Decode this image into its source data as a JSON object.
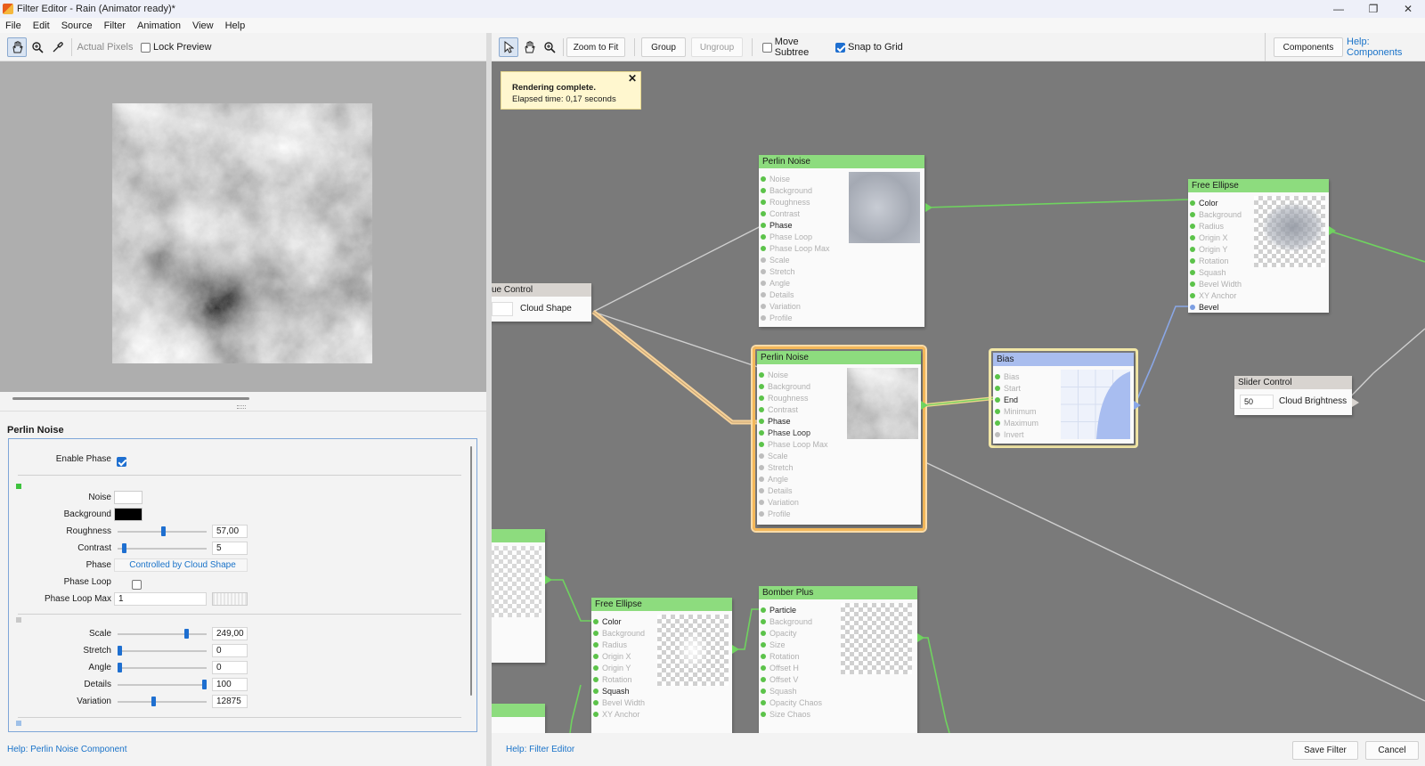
{
  "window": {
    "title": "Filter Editor - Rain (Animator ready)*"
  },
  "menu": [
    "File",
    "Edit",
    "Source",
    "Filter",
    "Animation",
    "View",
    "Help"
  ],
  "left_toolbar": {
    "actual_pixels": "Actual Pixels",
    "lock_preview": "Lock Preview"
  },
  "right_toolbar": {
    "zoom_to_fit": "Zoom to Fit",
    "group": "Group",
    "ungroup": "Ungroup",
    "move_subtree": "Move Subtree",
    "snap_to_grid": "Snap to Grid",
    "components": "Components",
    "help_components": "Help: Components"
  },
  "toast": {
    "title": "Rendering complete.",
    "subtitle": "Elapsed time: 0,17 seconds"
  },
  "properties": {
    "title": "Perlin Noise",
    "enable_phase": "Enable Phase",
    "noise": "Noise",
    "background": "Background",
    "roughness": "Roughness",
    "roughness_value": "57,00",
    "contrast": "Contrast",
    "contrast_value": "5",
    "phase": "Phase",
    "phase_value": "Controlled by Cloud Shape",
    "phase_loop": "Phase Loop",
    "phase_loop_max": "Phase Loop Max",
    "phase_loop_max_value": "1",
    "scale": "Scale",
    "scale_value": "249,00",
    "stretch": "Stretch",
    "stretch_value": "0",
    "angle": "Angle",
    "angle_value": "0",
    "details": "Details",
    "details_value": "100",
    "variation": "Variation",
    "variation_value": "12875",
    "progress": {
      "roughness": 0.52,
      "contrast": 0.05,
      "scale": 0.79,
      "stretch": 0.0,
      "angle": 0.0,
      "details": 1.0,
      "variation": 0.4
    }
  },
  "nodes": {
    "value_control": {
      "title": "ue Control",
      "label": "Cloud Shape"
    },
    "perlin1": {
      "title": "Perlin Noise",
      "ports": [
        "Noise",
        "Background",
        "Roughness",
        "Contrast",
        "Phase",
        "Phase Loop",
        "Phase Loop Max",
        "Scale",
        "Stretch",
        "Angle",
        "Details",
        "Variation",
        "Profile"
      ]
    },
    "perlin2": {
      "title": "Perlin Noise",
      "ports": [
        "Noise",
        "Background",
        "Roughness",
        "Contrast",
        "Phase",
        "Phase Loop",
        "Phase Loop Max",
        "Scale",
        "Stretch",
        "Angle",
        "Details",
        "Variation",
        "Profile"
      ]
    },
    "bias": {
      "title": "Bias",
      "ports": [
        "Bias",
        "Start",
        "End",
        "Minimum",
        "Maximum",
        "Invert"
      ]
    },
    "free_ellipse1": {
      "title": "Free Ellipse",
      "ports": [
        "Color",
        "Background",
        "Radius",
        "Origin X",
        "Origin Y",
        "Rotation",
        "Squash",
        "Bevel Width",
        "XY Anchor",
        "Bevel"
      ]
    },
    "slider_control": {
      "title": "Slider Control",
      "value": "50",
      "label": "Cloud Brightness"
    },
    "free_ellipse2": {
      "title": "Free Ellipse",
      "ports": [
        "Color",
        "Background",
        "Radius",
        "Origin X",
        "Origin Y",
        "Rotation",
        "Squash",
        "Bevel Width",
        "XY Anchor"
      ]
    },
    "bomber_plus": {
      "title": "Bomber Plus",
      "ports": [
        "Particle",
        "Background",
        "Opacity",
        "Size",
        "Rotation",
        "Offset H",
        "Offset V",
        "Squash",
        "Opacity Chaos",
        "Size Chaos"
      ]
    }
  },
  "status": {
    "left_help": "Help: Perlin Noise Component",
    "right_help": "Help: Filter Editor",
    "save": "Save Filter",
    "cancel": "Cancel"
  }
}
